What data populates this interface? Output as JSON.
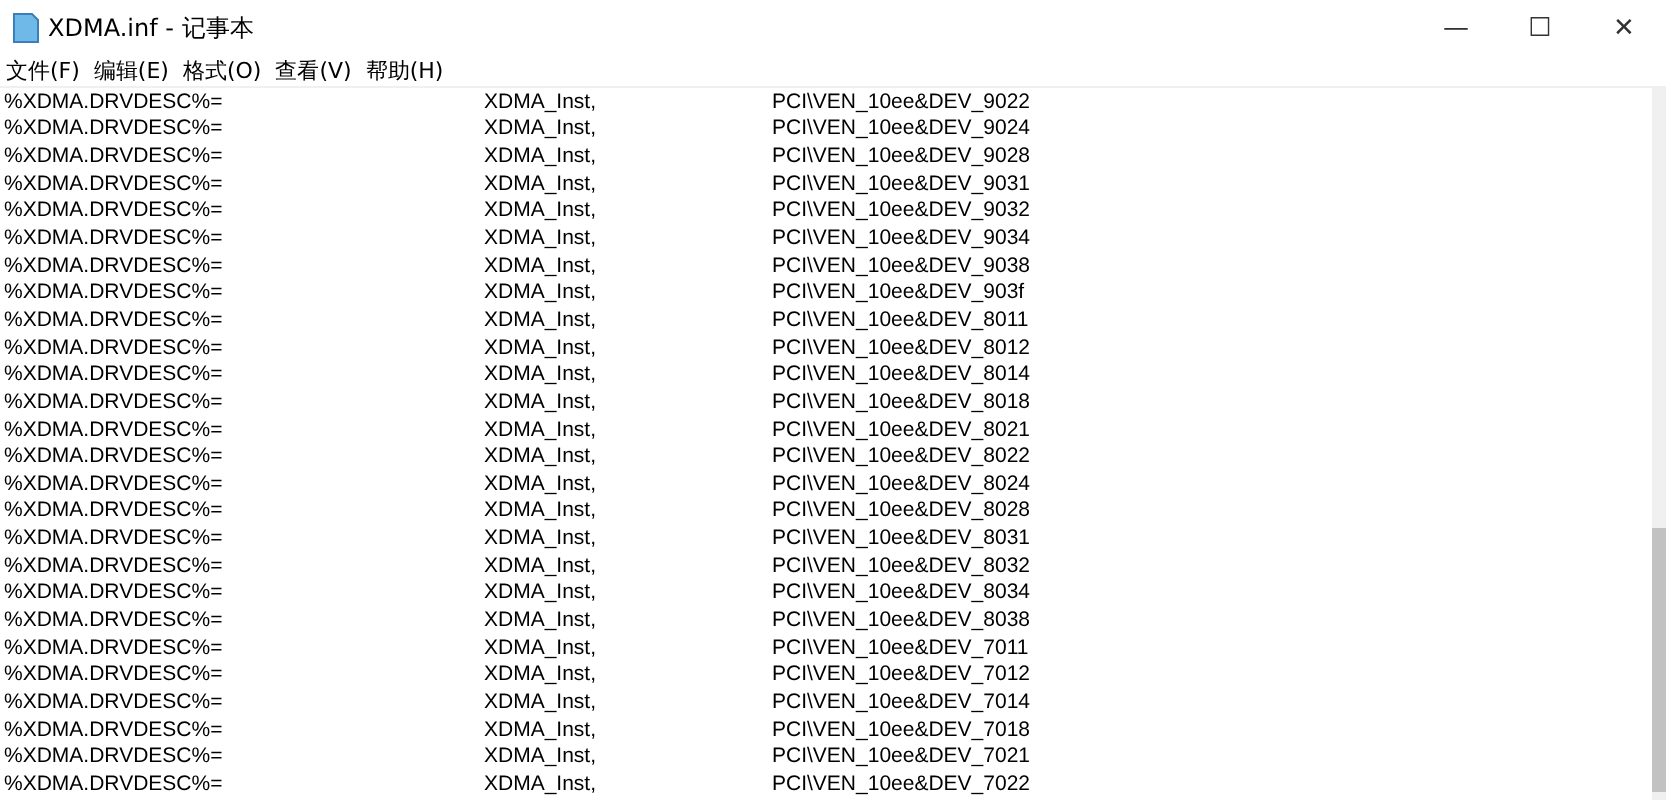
{
  "window": {
    "title": "XDMA.inf - 记事本",
    "controls": [
      "—",
      "☐",
      "✕"
    ]
  },
  "menu": [
    "文件(F)",
    "编辑(E)",
    "格式(O)",
    "查看(V)",
    "帮助(H)"
  ],
  "lines": [
    [
      "%XDMA.DRVDESC%=",
      "XDMA_Inst,",
      "PCI\\VEN_10ee&DEV_9022"
    ],
    [
      "%XDMA.DRVDESC%=",
      "XDMA_Inst,",
      "PCI\\VEN_10ee&DEV_9024"
    ],
    [
      "%XDMA.DRVDESC%=",
      "XDMA_Inst,",
      "PCI\\VEN_10ee&DEV_9028"
    ],
    [
      "%XDMA.DRVDESC%=",
      "XDMA_Inst,",
      "PCI\\VEN_10ee&DEV_9031"
    ],
    [
      "%XDMA.DRVDESC%=",
      "XDMA_Inst,",
      "PCI\\VEN_10ee&DEV_9032"
    ],
    [
      "%XDMA.DRVDESC%=",
      "XDMA_Inst,",
      "PCI\\VEN_10ee&DEV_9034"
    ],
    [
      "%XDMA.DRVDESC%=",
      "XDMA_Inst,",
      "PCI\\VEN_10ee&DEV_9038"
    ],
    [
      "%XDMA.DRVDESC%=",
      "XDMA_Inst,",
      "PCI\\VEN_10ee&DEV_903f"
    ],
    [
      "%XDMA.DRVDESC%=",
      "XDMA_Inst,",
      "PCI\\VEN_10ee&DEV_8011"
    ],
    [
      "%XDMA.DRVDESC%=",
      "XDMA_Inst,",
      "PCI\\VEN_10ee&DEV_8012"
    ],
    [
      "%XDMA.DRVDESC%=",
      "XDMA_Inst,",
      "PCI\\VEN_10ee&DEV_8014"
    ],
    [
      "%XDMA.DRVDESC%=",
      "XDMA_Inst,",
      "PCI\\VEN_10ee&DEV_8018"
    ],
    [
      "%XDMA.DRVDESC%=",
      "XDMA_Inst,",
      "PCI\\VEN_10ee&DEV_8021"
    ],
    [
      "%XDMA.DRVDESC%=",
      "XDMA_Inst,",
      "PCI\\VEN_10ee&DEV_8022"
    ],
    [
      "%XDMA.DRVDESC%=",
      "XDMA_Inst,",
      "PCI\\VEN_10ee&DEV_8024"
    ],
    [
      "%XDMA.DRVDESC%=",
      "XDMA_Inst,",
      "PCI\\VEN_10ee&DEV_8028"
    ],
    [
      "%XDMA.DRVDESC%=",
      "XDMA_Inst,",
      "PCI\\VEN_10ee&DEV_8031"
    ],
    [
      "%XDMA.DRVDESC%=",
      "XDMA_Inst,",
      "PCI\\VEN_10ee&DEV_8032"
    ],
    [
      "%XDMA.DRVDESC%=",
      "XDMA_Inst,",
      "PCI\\VEN_10ee&DEV_8034"
    ],
    [
      "%XDMA.DRVDESC%=",
      "XDMA_Inst,",
      "PCI\\VEN_10ee&DEV_8038"
    ],
    [
      "%XDMA.DRVDESC%=",
      "XDMA_Inst,",
      "PCI\\VEN_10ee&DEV_7011"
    ],
    [
      "%XDMA.DRVDESC%=",
      "XDMA_Inst,",
      "PCI\\VEN_10ee&DEV_7012"
    ],
    [
      "%XDMA.DRVDESC%=",
      "XDMA_Inst,",
      "PCI\\VEN_10ee&DEV_7014"
    ],
    [
      "%XDMA.DRVDESC%=",
      "XDMA_Inst,",
      "PCI\\VEN_10ee&DEV_7018"
    ],
    [
      "%XDMA.DRVDESC%=",
      "XDMA_Inst,",
      "PCI\\VEN_10ee&DEV_7021"
    ],
    [
      "%XDMA.DRVDESC%=",
      "XDMA_Inst,",
      "PCI\\VEN_10ee&DEV_7022"
    ]
  ]
}
